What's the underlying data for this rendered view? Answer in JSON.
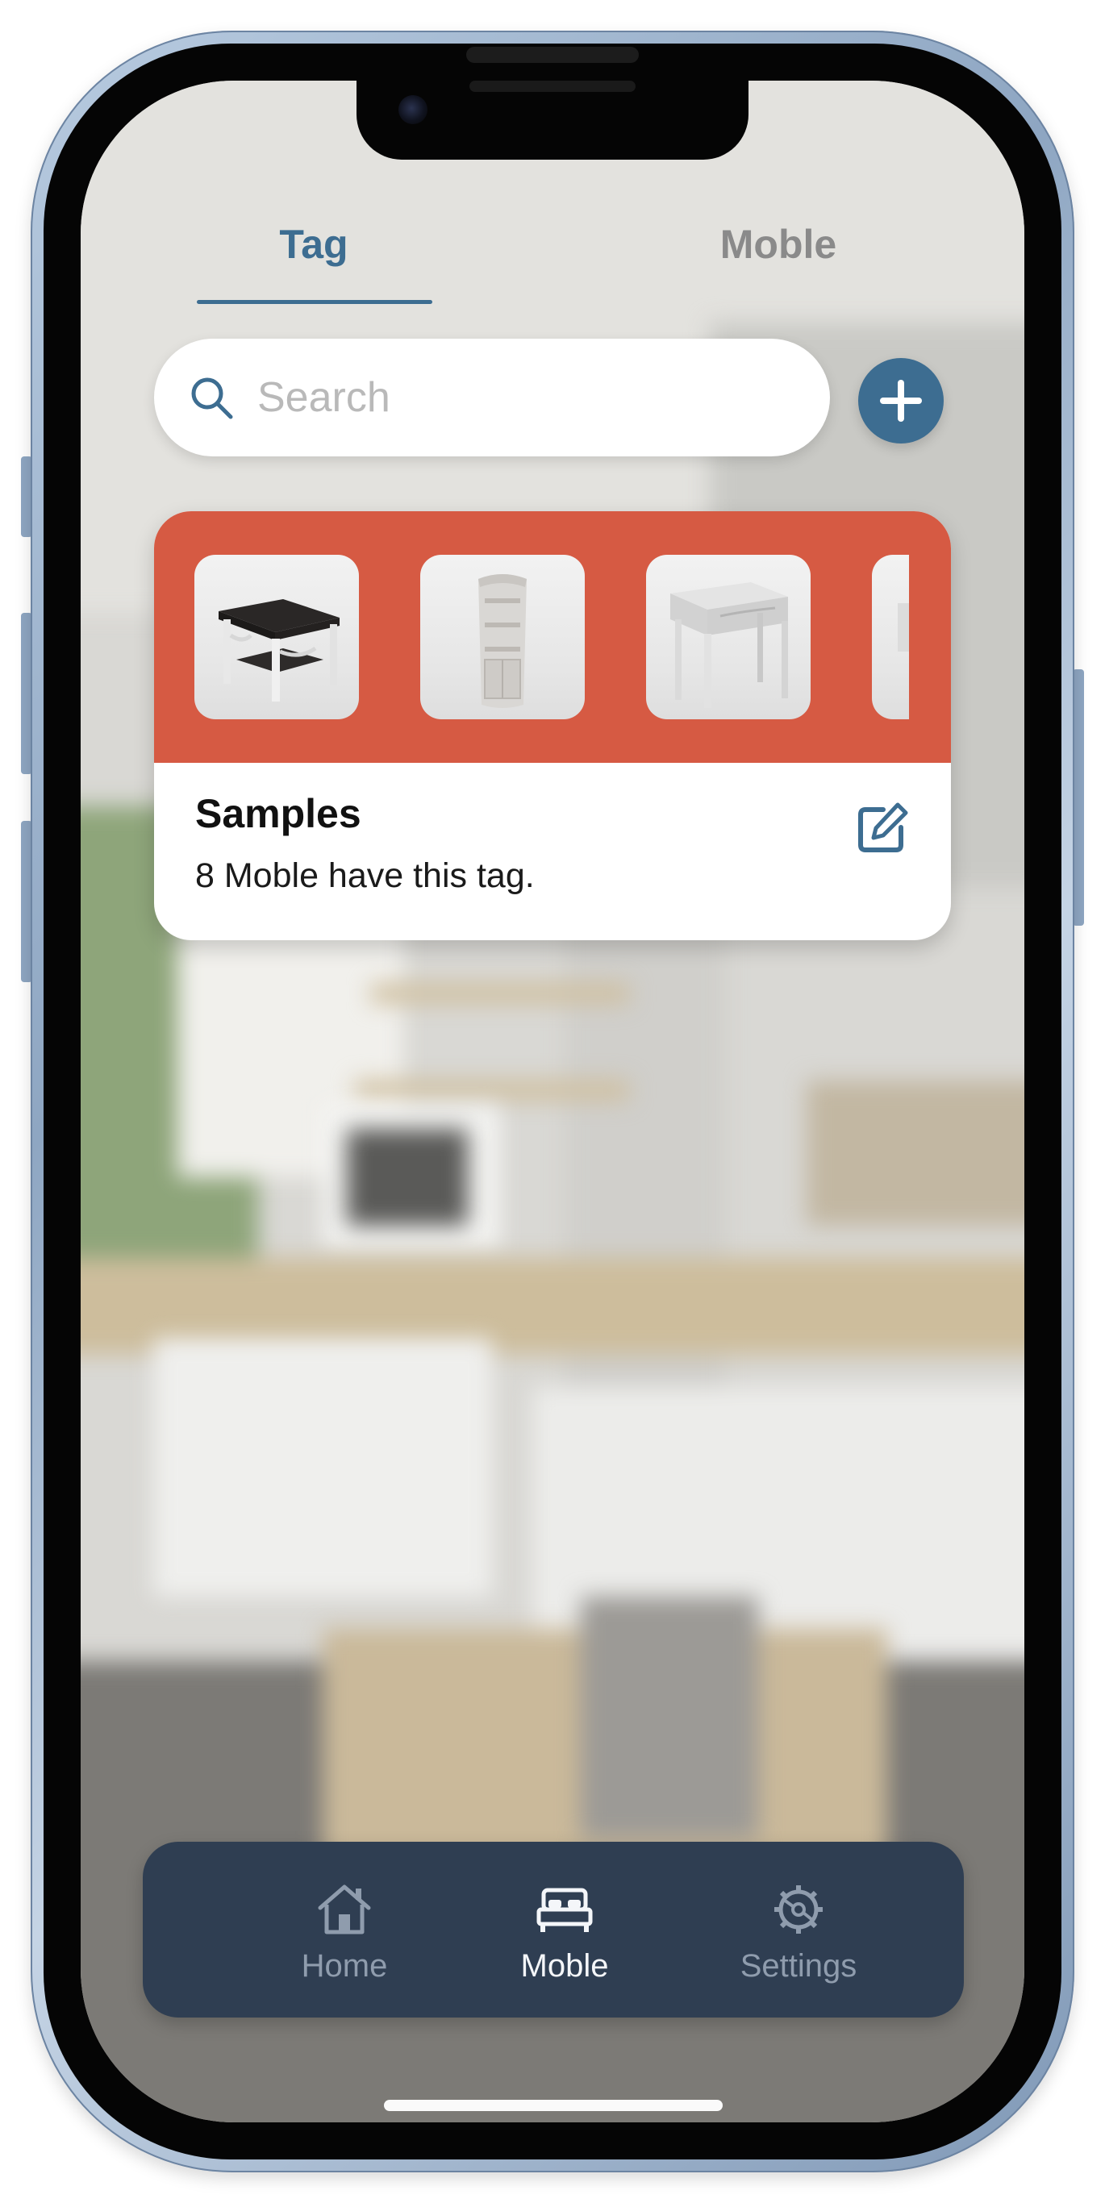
{
  "tabs": [
    {
      "label": "Tag",
      "active": true
    },
    {
      "label": "Moble",
      "active": false
    }
  ],
  "search": {
    "placeholder": "Search",
    "value": "",
    "icon": "search-icon"
  },
  "add_button": {
    "icon": "plus-icon"
  },
  "tag_card": {
    "title": "Samples",
    "subtitle": "8 Moble have this tag.",
    "header_color": "#d65a43",
    "thumbnails": [
      "table-thumbnail",
      "corner-shelf-thumbnail",
      "side-table-thumbnail",
      "item-thumbnail"
    ],
    "edit_icon": "edit-icon"
  },
  "bottom_nav": {
    "items": [
      {
        "label": "Home",
        "icon": "home-icon",
        "active": false
      },
      {
        "label": "Moble",
        "icon": "bed-icon",
        "active": true
      },
      {
        "label": "Settings",
        "icon": "settings-gear-icon",
        "active": false
      }
    ]
  },
  "colors": {
    "accent": "#3d6d91",
    "tag_red": "#d65a43",
    "nav_bg": "#2f3e52"
  }
}
